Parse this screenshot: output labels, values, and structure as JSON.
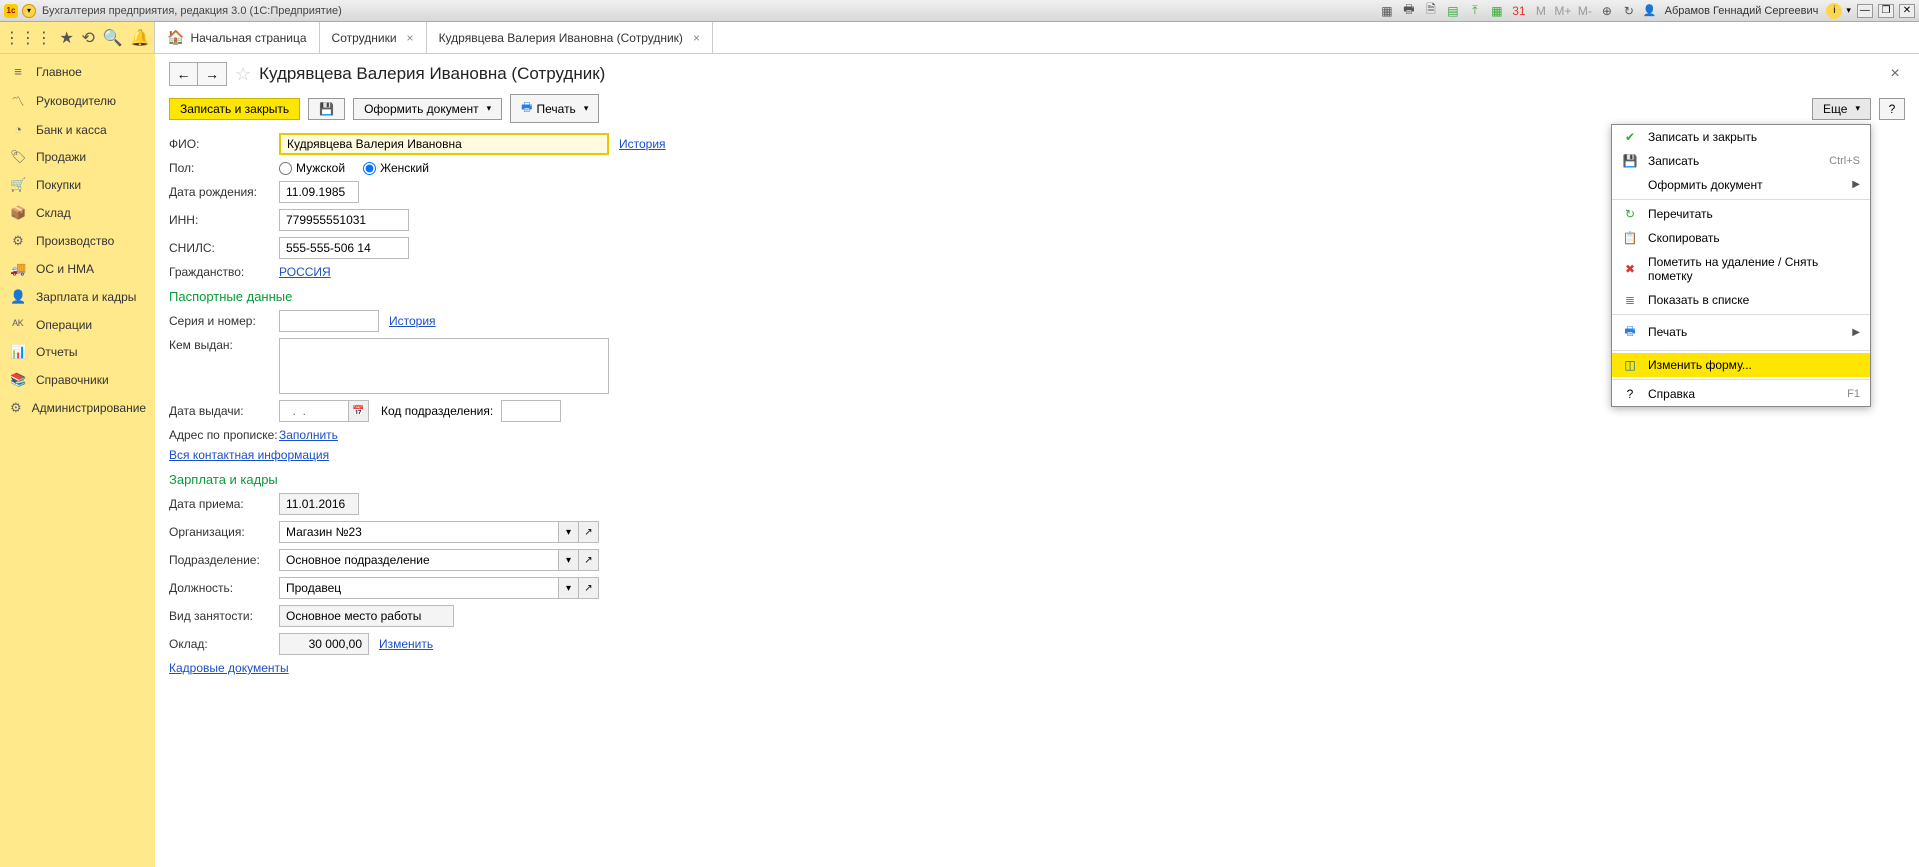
{
  "titlebar": {
    "title": "Бухгалтерия предприятия, редакция 3.0  (1С:Предприятие)",
    "user": "Абрамов Геннадий Сергеевич"
  },
  "tabs": {
    "home": "Начальная страница",
    "t1": "Сотрудники",
    "t2": "Кудрявцева Валерия Ивановна (Сотрудник)"
  },
  "sidebar": {
    "items": [
      {
        "label": "Главное"
      },
      {
        "label": "Руководителю"
      },
      {
        "label": "Банк и касса"
      },
      {
        "label": "Продажи"
      },
      {
        "label": "Покупки"
      },
      {
        "label": "Склад"
      },
      {
        "label": "Производство"
      },
      {
        "label": "ОС и НМА"
      },
      {
        "label": "Зарплата и кадры"
      },
      {
        "label": "Операции"
      },
      {
        "label": "Отчеты"
      },
      {
        "label": "Справочники"
      },
      {
        "label": "Администрирование"
      }
    ]
  },
  "page": {
    "title": "Кудрявцева Валерия Ивановна (Сотрудник)"
  },
  "actions": {
    "save_close": "Записать и закрыть",
    "doc": "Оформить документ",
    "print": "Печать",
    "more": "Еще",
    "help": "?"
  },
  "form": {
    "fio_label": "ФИО:",
    "fio": "Кудрявцева Валерия Ивановна",
    "history": "История",
    "gender_label": "Пол:",
    "gender_male": "Мужской",
    "gender_female": "Женский",
    "dob_label": "Дата рождения:",
    "dob": "11.09.1985",
    "inn_label": "ИНН:",
    "inn": "779955551031",
    "snils_label": "СНИЛС:",
    "snils": "555-555-506 14",
    "citizenship_label": "Гражданство:",
    "citizenship": "РОССИЯ",
    "passport_section": "Паспортные данные",
    "series_label": "Серия и номер:",
    "issued_by_label": "Кем выдан:",
    "issue_date_label": "Дата выдачи:",
    "issue_date_placeholder": "  .  .    ",
    "subdiv_code_label": "Код подразделения:",
    "reg_address_label": "Адрес по прописке:",
    "fill_link": "Заполнить",
    "all_contacts": "Вся контактная информация",
    "hr_section": "Зарплата и кадры",
    "hire_date_label": "Дата приема:",
    "hire_date": "11.01.2016",
    "org_label": "Организация:",
    "org": "Магазин №23",
    "dept_label": "Подразделение:",
    "dept": "Основное подразделение",
    "position_label": "Должность:",
    "position": "Продавец",
    "employment_label": "Вид занятости:",
    "employment": "Основное место работы",
    "salary_label": "Оклад:",
    "salary": "30 000,00",
    "change_link": "Изменить",
    "hr_docs": "Кадровые документы"
  },
  "menu": {
    "save_close": "Записать и закрыть",
    "save": "Записать",
    "save_shortcut": "Ctrl+S",
    "create_doc": "Оформить документ",
    "reread": "Перечитать",
    "copy": "Скопировать",
    "mark_delete": "Пометить на удаление / Снять пометку",
    "show_in_list": "Показать в списке",
    "print": "Печать",
    "change_form": "Изменить форму...",
    "help": "Справка",
    "help_shortcut": "F1"
  }
}
